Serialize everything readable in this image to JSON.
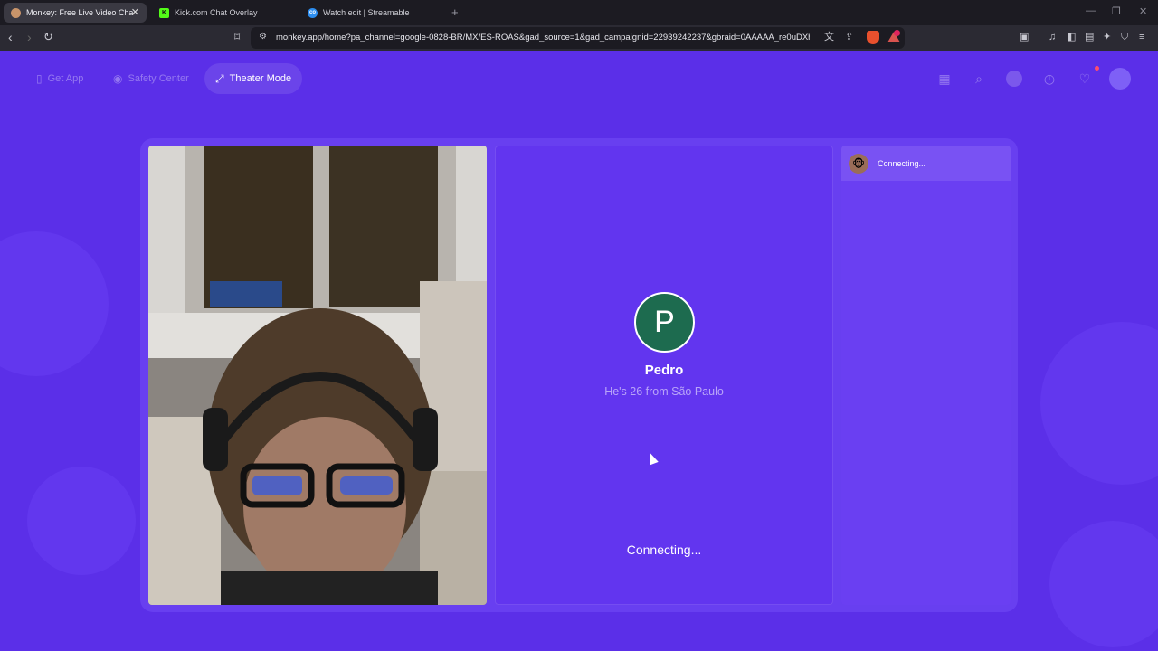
{
  "browser": {
    "tabs": [
      {
        "title": "Monkey: Free Live Video Cha",
        "favicon_color": "#c8946a",
        "active": true
      },
      {
        "title": "Kick.com Chat Overlay",
        "favicon_color": "#53fc18",
        "favicon_char": "K",
        "active": false
      },
      {
        "title": "Watch edit | Streamable",
        "favicon_color": "#2d8ef0",
        "favicon_char": "co",
        "active": false
      }
    ],
    "url": "monkey.app/home?pa_channel=google-0828-BR/MX/ES-ROAS&gad_source=1&gad_campaignid=22939242237&gbraid=0AAAAA_re0uDXhg..."
  },
  "topnav": {
    "get_app": "Get App",
    "safety_center": "Safety Center",
    "theater_mode": "Theater Mode"
  },
  "peer": {
    "initial": "P",
    "name": "Pedro",
    "info": "He's 26 from São Paulo",
    "status": "Connecting..."
  },
  "chat": {
    "status": "Connecting..."
  },
  "colors": {
    "page_bg": "#5b2fe8",
    "avatar_bg": "#1d6b4f"
  }
}
